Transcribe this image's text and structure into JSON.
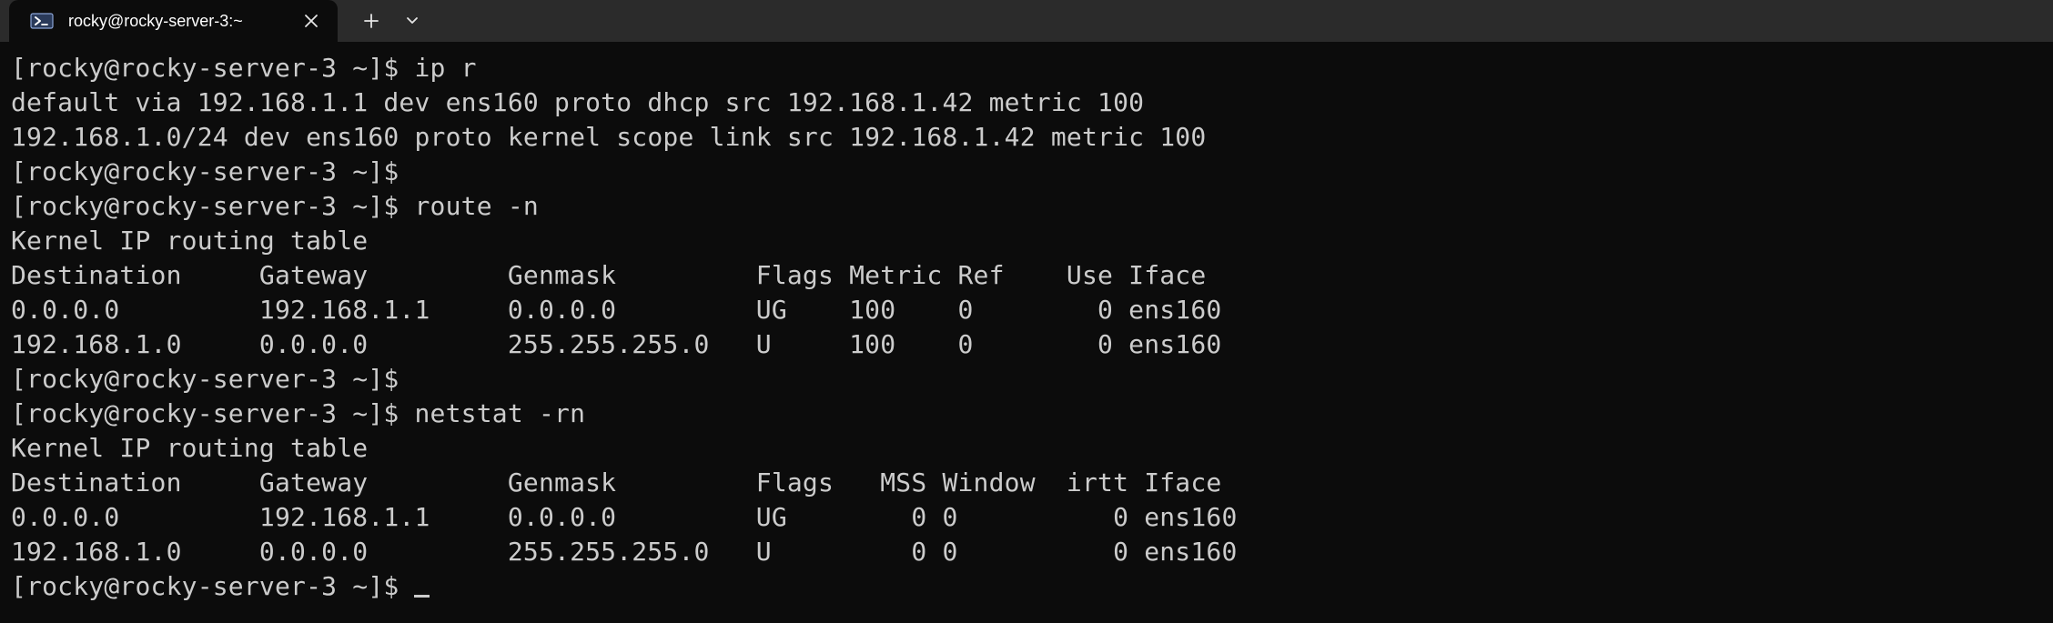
{
  "window": {
    "tab_title": "rocky@rocky-server-3:~",
    "tab_icon": "powershell-icon",
    "close_icon": "close-icon",
    "new_tab_icon": "plus-icon",
    "dropdown_icon": "chevron-down-icon"
  },
  "terminal": {
    "lines": [
      "[rocky@rocky-server-3 ~]$ ip r",
      "default via 192.168.1.1 dev ens160 proto dhcp src 192.168.1.42 metric 100",
      "192.168.1.0/24 dev ens160 proto kernel scope link src 192.168.1.42 metric 100",
      "[rocky@rocky-server-3 ~]$",
      "[rocky@rocky-server-3 ~]$ route -n",
      "Kernel IP routing table",
      "Destination     Gateway         Genmask         Flags Metric Ref    Use Iface",
      "0.0.0.0         192.168.1.1     0.0.0.0         UG    100    0        0 ens160",
      "192.168.1.0     0.0.0.0         255.255.255.0   U     100    0        0 ens160",
      "[rocky@rocky-server-3 ~]$",
      "[rocky@rocky-server-3 ~]$ netstat -rn",
      "Kernel IP routing table",
      "Destination     Gateway         Genmask         Flags   MSS Window  irtt Iface",
      "0.0.0.0         192.168.1.1     0.0.0.0         UG        0 0          0 ens160",
      "192.168.1.0     0.0.0.0         255.255.255.0   U         0 0          0 ens160",
      "[rocky@rocky-server-3 ~]$"
    ]
  },
  "colors": {
    "terminal_bg": "#0c0c0c",
    "titlebar_bg": "#2b2b2b",
    "text": "#cccccc"
  }
}
